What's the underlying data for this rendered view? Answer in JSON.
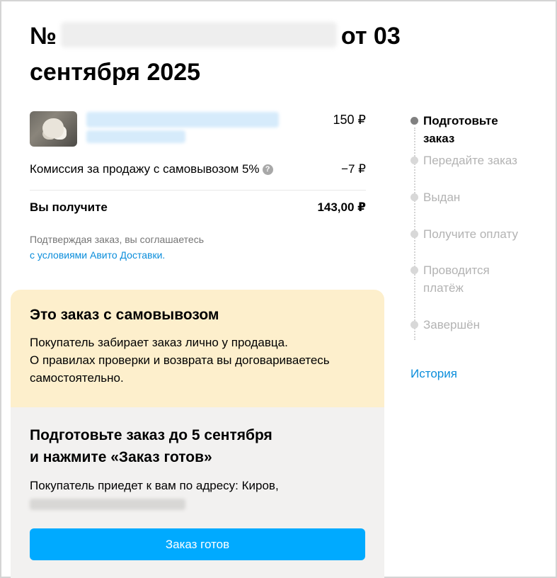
{
  "order": {
    "title_prefix": "№",
    "title_suffix": "от 03",
    "title_line2": "сентября 2025"
  },
  "item": {
    "price": "150 ₽"
  },
  "commission": {
    "label": "Комиссия за продажу с самовывозом 5%",
    "info_icon": "?",
    "value": "−7 ₽"
  },
  "receive": {
    "label": "Вы получите",
    "value": "143,00 ₽"
  },
  "terms": {
    "text": "Подтверждая заказ, вы соглашаетесь",
    "link": "с условиями Авито Доставки."
  },
  "pickup": {
    "title": "Это заказ с самовывозом",
    "line1": "Покупатель забирает заказ лично у продавца.",
    "line2": "О правилах проверки и возврата вы договариваетесь",
    "line3": "самостоятельно."
  },
  "prepare": {
    "title_line1": "Подготовьте заказ до 5 сентября",
    "title_line2": "и нажмите «Заказ готов»",
    "text": "Покупатель приедет к вам по адресу: Киров,",
    "button": "Заказ готов"
  },
  "steps": [
    {
      "label": "Подготовьте заказ",
      "state": "active"
    },
    {
      "label": "Передайте заказ",
      "state": "inactive"
    },
    {
      "label": "Выдан",
      "state": "inactive"
    },
    {
      "label": "Получите оплату",
      "state": "inactive"
    },
    {
      "label": "Проводится платёж",
      "state": "inactive"
    },
    {
      "label": "Завершён",
      "state": "inactive"
    }
  ],
  "history_link": "История",
  "colors": {
    "accent": "#00aaff",
    "link": "#0a8ddb",
    "pickup_bg": "#fdefcc",
    "prepare_bg": "#f2f1f0"
  }
}
